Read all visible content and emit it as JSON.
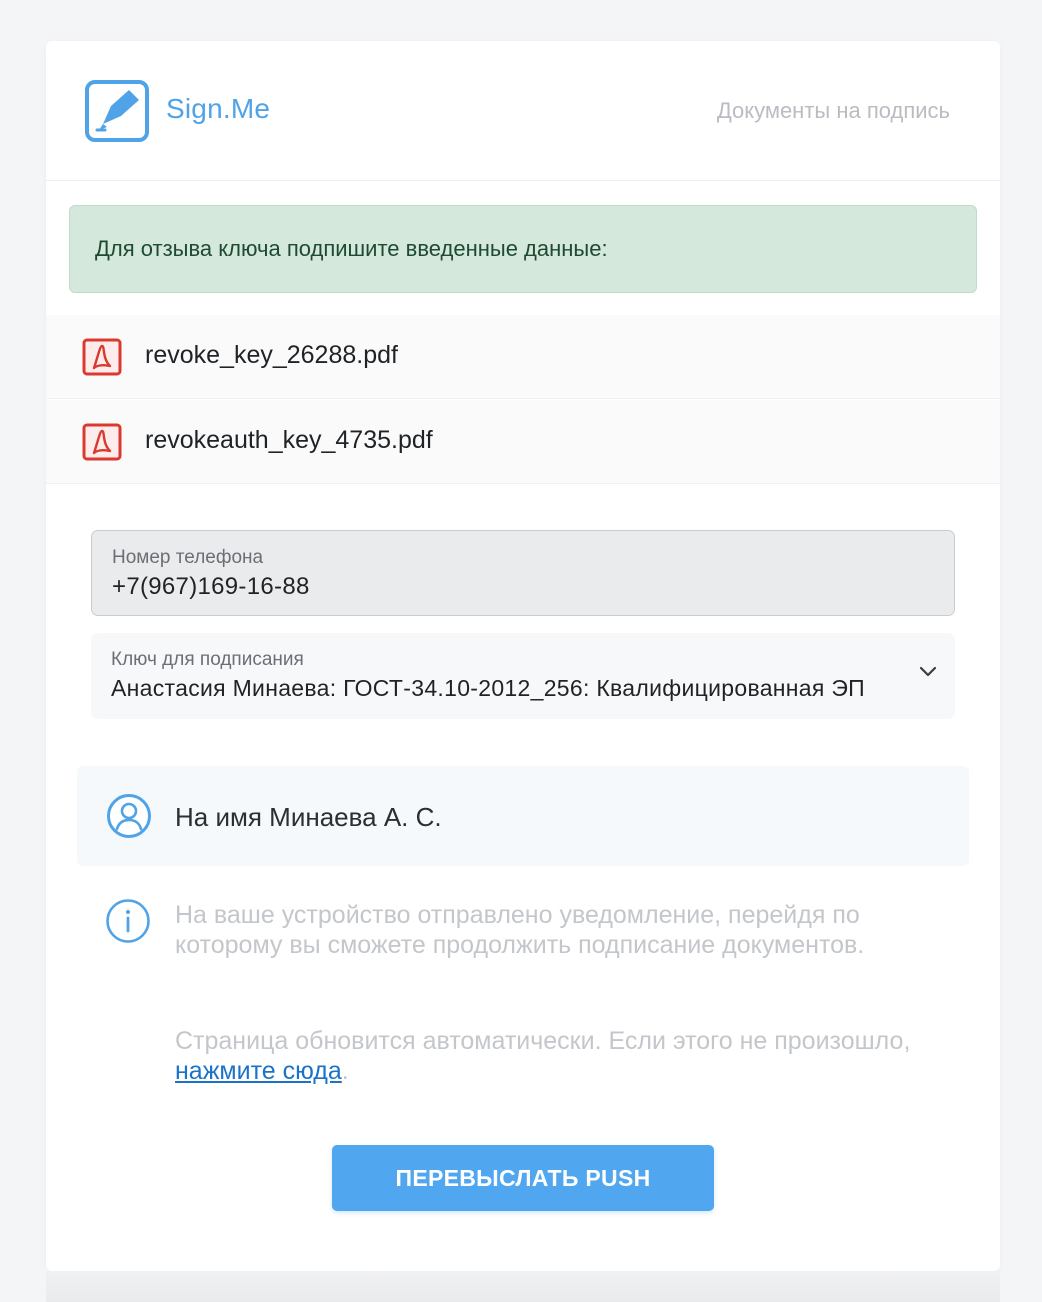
{
  "header": {
    "logo_text": "Sign.Me",
    "nav_link": "Документы на подпись"
  },
  "alert": {
    "text": "Для отзыва ключа подпишите введенные данные:"
  },
  "files": [
    {
      "name": "revoke_key_26288.pdf",
      "icon": "pdf-icon"
    },
    {
      "name": "revokeauth_key_4735.pdf",
      "icon": "pdf-icon"
    }
  ],
  "phone": {
    "label": "Номер телефона",
    "value": "+7(967)169-16-88"
  },
  "key": {
    "label": "Ключ для подписания",
    "value": "Анастасия Минаева: ГОСТ-34.10-2012_256: Квалифицированная ЭП"
  },
  "owner": {
    "icon": "user-icon",
    "text": "На имя Минаева А. С."
  },
  "info": {
    "icon": "info-icon",
    "text": "На ваше устройство отправлено уведомление, перейдя по которому вы сможете продолжить подписание документов.",
    "refresh_prefix": "Страница обновится автоматически. Если этого не произошло, ",
    "refresh_link": "нажмите сюда",
    "refresh_suffix": "."
  },
  "button": {
    "label": "ПЕРЕВЫСЛАТЬ PUSH"
  },
  "colors": {
    "brand": "#4fa3e6",
    "alert_bg": "#d5e8dc",
    "pdf_red": "#d9392f",
    "link": "#1a73c8",
    "button": "#50a7ef"
  }
}
